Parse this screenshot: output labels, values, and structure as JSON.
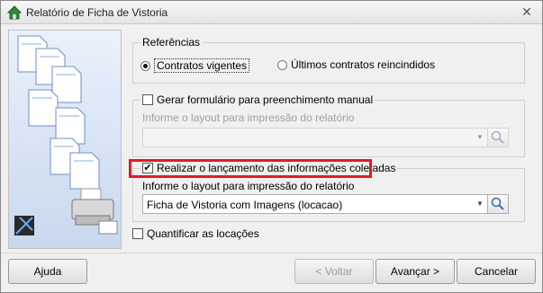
{
  "window": {
    "title": "Relatório de Ficha de Vistoria",
    "icon": "home-icon",
    "close_icon": "close-icon"
  },
  "referencias": {
    "legend": "Referências",
    "options": [
      {
        "label": "Contratos vigentes",
        "selected": true
      },
      {
        "label": "Últimos contratos reincindidos",
        "selected": false
      }
    ]
  },
  "formulario": {
    "label": "Gerar formulário para preenchimento manual",
    "checked": false,
    "layout_label": "Informe o layout para impressão do relatório",
    "layout_value": ""
  },
  "lancamento": {
    "label": "Realizar o lançamento das informações coletadas",
    "checked": true,
    "layout_label": "Informe o layout para impressão do relatório",
    "layout_value": "Ficha de Vistoria com Imagens (locacao)"
  },
  "quantificar": {
    "label": "Quantificar as locações",
    "checked": false
  },
  "buttons": {
    "help": "Ajuda",
    "back": "< Voltar",
    "next": "Avançar >",
    "cancel": "Cancelar"
  },
  "colors": {
    "highlight": "#e21b23"
  }
}
